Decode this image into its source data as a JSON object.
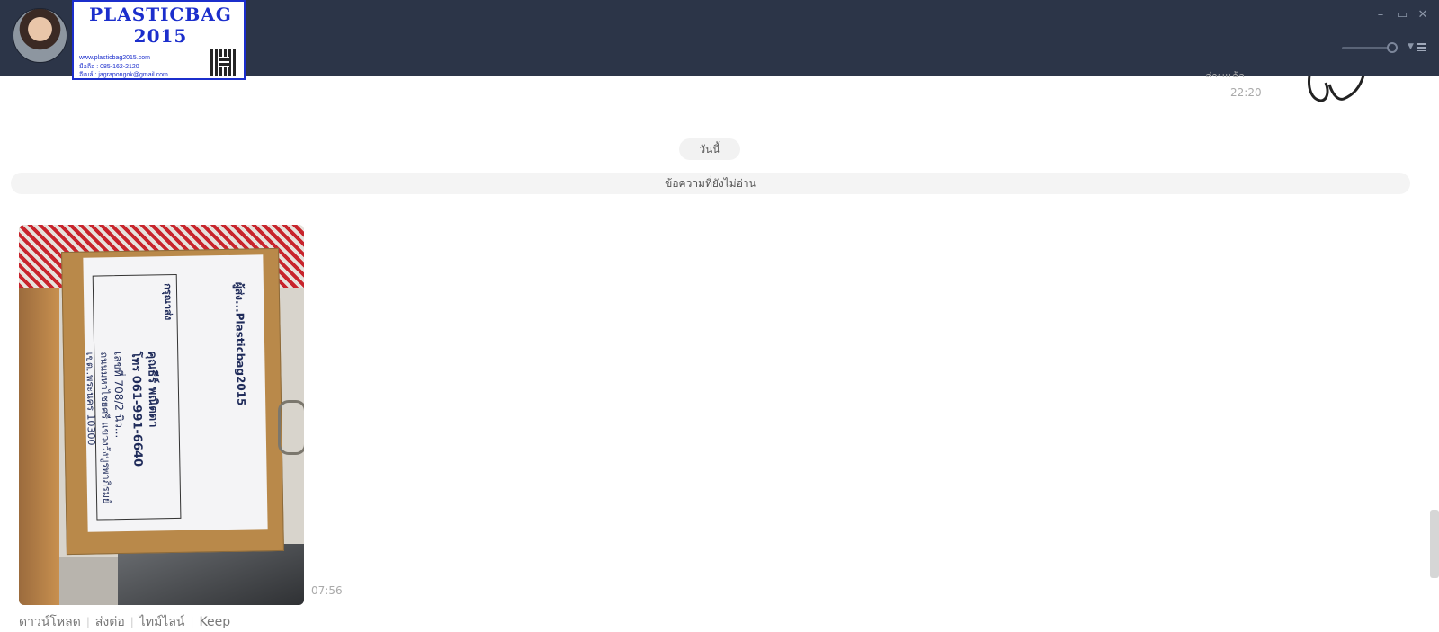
{
  "header": {
    "banner": {
      "title": "PLASTICBAG\n2015",
      "website": "www.plasticbag2015.com",
      "phone": "มือถือ : 085-162-2120",
      "email": "อีเมล์ : jagrapongok@gmail.com"
    },
    "controls": {
      "minimize": "–",
      "restore": "▭",
      "close": "✕"
    }
  },
  "chat": {
    "previous_message": {
      "read_status": "อ่านแล้ว",
      "time": "22:20"
    },
    "date_divider": "วันนี้",
    "unread_divider": "ข้อความที่ยังไม่อ่าน",
    "incoming_image": {
      "time": "07:56",
      "label_texts": {
        "brand": "ผู้ส่ง...Plasticbag2015",
        "recipient": "คุณธีร์ พณิตดา",
        "phone": "โทร 061-991-6640",
        "address1": "เลขที่ 708/2 นิว...",
        "address2": "ถนนมหาไชยศรี แขวงวังบูรพาภิรมย์",
        "zip": "เขต..พระนคร 10300",
        "to": "กรุณาส่ง"
      }
    },
    "actions": [
      "ดาวน์โหลด",
      "ส่งต่อ",
      "ไทม์ไลน์",
      "Keep"
    ]
  }
}
